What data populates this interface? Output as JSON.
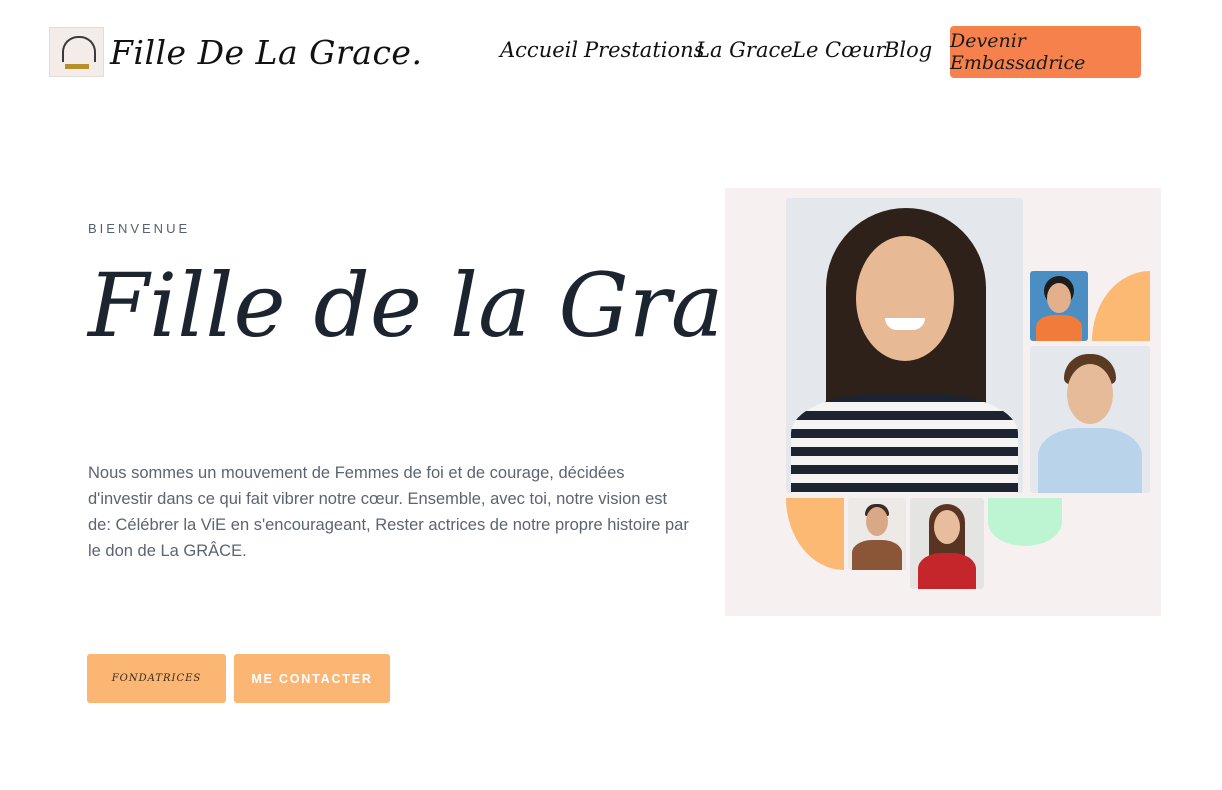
{
  "header": {
    "logo_text": "Fille De La Grace.",
    "nav": [
      "Accueil",
      "Prestations",
      "La Grace",
      "Le Cœur",
      "Blog"
    ],
    "cta_label": "Devenir Embassadrice"
  },
  "hero": {
    "eyebrow": "BIENVENUE",
    "title": "Fille de la Grace",
    "description": "Nous sommes un mouvement  de Femmes de foi et de courage, décidées d'investir dans ce qui fait vibrer notre cœur. Ensemble, avec toi, notre vision est de: Célébrer la ViE en s'encourageant, Rester actrices de notre propre histoire par le don de La GRÂCE.",
    "button_primary": "FONDATRICES",
    "button_secondary": "ME CONTACTER"
  },
  "colors": {
    "accent_orange": "#f6814d",
    "button_peach": "#fbb673",
    "mint": "#bdf5d2",
    "collage_bg": "#f6f1f0"
  }
}
